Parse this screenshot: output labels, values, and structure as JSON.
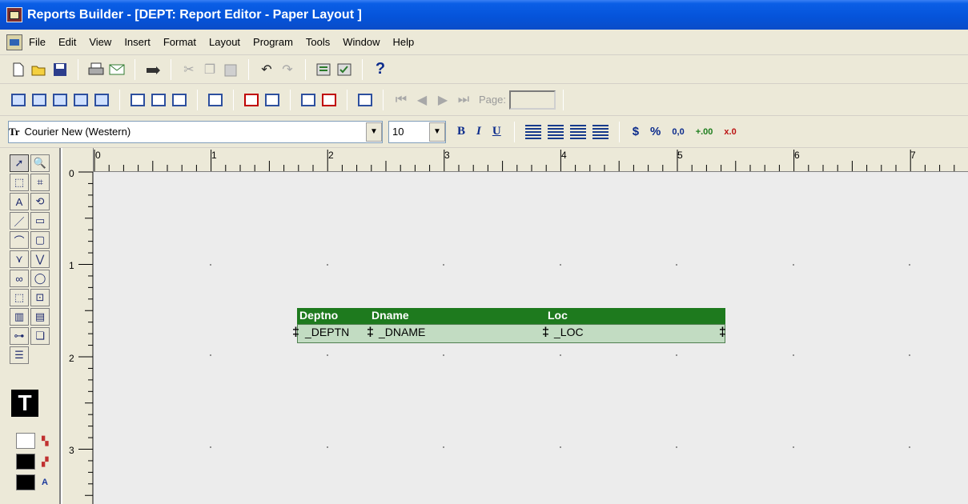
{
  "window": {
    "title": "Reports Builder - [DEPT: Report Editor - Paper Layout ]"
  },
  "menu": [
    "File",
    "Edit",
    "View",
    "Insert",
    "Format",
    "Layout",
    "Program",
    "Tools",
    "Window",
    "Help"
  ],
  "toolbar_top": {
    "help_glyph": "?",
    "buttons": [
      "new-icon",
      "open-icon",
      "save-icon",
      "print-icon",
      "mail-icon",
      "run-icon",
      "cut-icon",
      "copy-icon",
      "paste-icon",
      "undo-icon",
      "redo-icon",
      "compile-icon",
      "check-icon",
      "help-icon"
    ]
  },
  "toolbar_layout": {
    "page_label": "Page:",
    "page_value": ""
  },
  "toolbar_format": {
    "font_icon_glyph": "Tr",
    "font_name": "Courier New (Western)",
    "font_size": "10",
    "bold": "B",
    "italic": "I",
    "underline": "U",
    "currency": "$",
    "percent": "%",
    "comma": "0,0",
    "add_decimal": "+.00",
    "remove_decimal": "x.0"
  },
  "palette": {
    "text_tool_glyph": "T",
    "tools": [
      "select-icon",
      "magnify-icon",
      "frame-select-icon",
      "reshape-icon",
      "text-icon",
      "rotate-icon",
      "line-icon",
      "rectangle-icon",
      "arc-icon",
      "rounded-rect-icon",
      "polyline-icon",
      "polygon-icon",
      "freehand-icon",
      "ellipse-icon",
      "frame-icon",
      "field-icon",
      "chart-icon",
      "button-icon",
      "link-icon",
      "file-link-icon",
      "query-icon"
    ]
  },
  "rulers": {
    "horizontal": [
      "0",
      "1",
      "2",
      "3",
      "4",
      "5",
      "6",
      "7"
    ],
    "vertical": [
      "0",
      "1",
      "2",
      "3"
    ]
  },
  "report": {
    "columns": [
      {
        "label": "Deptno",
        "field": "_DEPTN"
      },
      {
        "label": "Dname",
        "field": "_DNAME"
      },
      {
        "label": "Loc",
        "field": "_LOC"
      }
    ]
  }
}
